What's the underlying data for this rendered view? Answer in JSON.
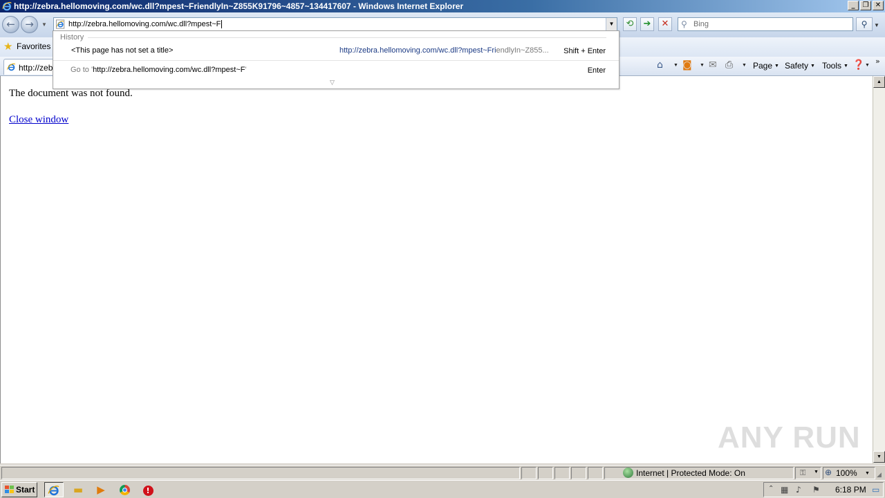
{
  "window": {
    "title": "http://zebra.hellomoving.com/wc.dll?mpest~FriendlyIn~Z855K91796~4857~134417607 - Windows Internet Explorer",
    "min_label": "_",
    "max_label": "❐",
    "close_label": "✕"
  },
  "navbar": {
    "address_value": "http://zebra.hellomoving.com/wc.dll?mpest~F",
    "search_placeholder": "Bing"
  },
  "favorites": {
    "label": "Favorites"
  },
  "tab": {
    "label": "http://zeb"
  },
  "commands": {
    "page": "Page",
    "safety": "Safety",
    "tools": "Tools"
  },
  "autocomplete": {
    "header": "History",
    "item_title": "<This page has not set a title>",
    "item_url_match": "http://zebra.hellomoving.com/wc.dll?mpest~Fri",
    "item_url_rest": "endlyIn~Z855...",
    "item_key": "Shift + Enter",
    "goto_prefix": "Go to '",
    "goto_url": "http://zebra.hellomoving.com/wc.dll?mpest~F",
    "goto_suffix": "'",
    "goto_key": "Enter"
  },
  "content": {
    "message": "The document was not found.",
    "close_link": "Close window"
  },
  "statusbar": {
    "zone": "Internet | Protected Mode: On",
    "zoom": "100%"
  },
  "taskbar": {
    "start_label": "Start",
    "clock": "6:18 PM"
  },
  "watermark": "ANY RUN",
  "colors": {
    "link": "#0000cc",
    "titlebar": "#0a246a"
  }
}
